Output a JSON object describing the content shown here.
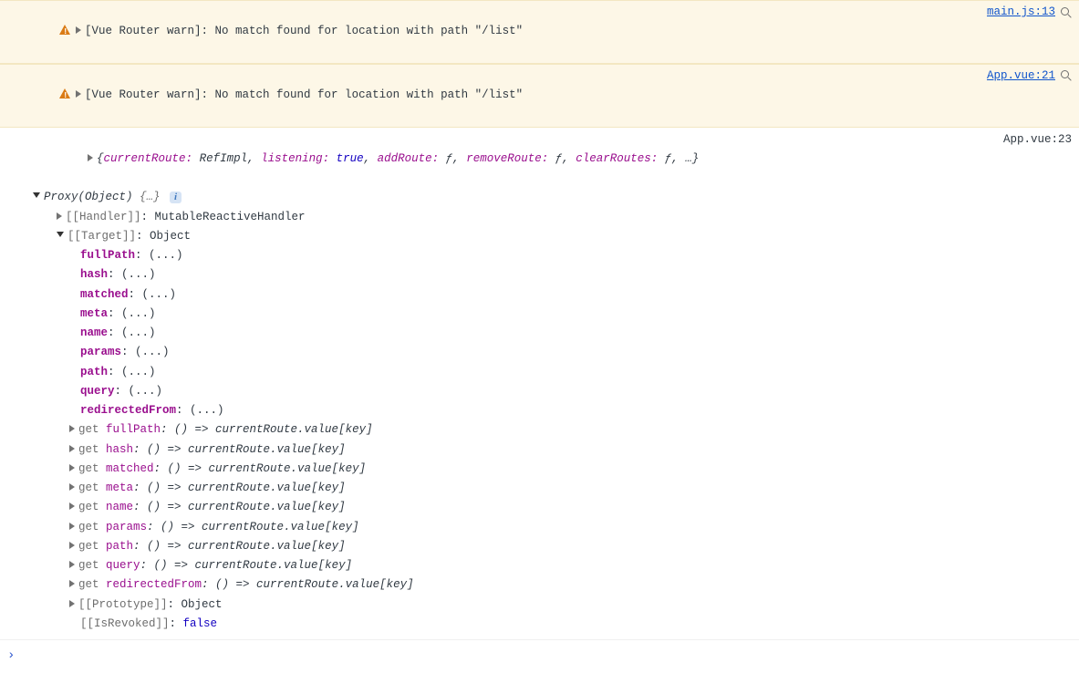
{
  "warns": [
    {
      "text": "[Vue Router warn]: No match found for location with path \"/list\"",
      "src": "main.js:13"
    },
    {
      "text": "[Vue Router warn]: No match found for location with path \"/list\"",
      "src": "App.vue:21"
    }
  ],
  "log": {
    "src": "App.vue:23",
    "summary_parts": {
      "open": "{",
      "p1k": "currentRoute:",
      "p1v": " RefImpl",
      "sep": ", ",
      "p2k": "listening:",
      "p2v": " true",
      "p3k": "addRoute:",
      "p3v": " ƒ",
      "p4k": "removeRoute:",
      "p4v": " ƒ",
      "p5k": "clearRoutes:",
      "p5v": " ƒ",
      "ell": ", …",
      "close": "}"
    },
    "proxy": {
      "label": "Proxy(Object)",
      "braces": " {…}",
      "handler_label": "[[Handler]]",
      "handler_val": ": MutableReactiveHandler",
      "target_label": "[[Target]]",
      "target_val": ": Object",
      "props": [
        {
          "k": "fullPath",
          "v": ": (...)"
        },
        {
          "k": "hash",
          "v": ": (...)"
        },
        {
          "k": "matched",
          "v": ": (...)"
        },
        {
          "k": "meta",
          "v": ": (...)"
        },
        {
          "k": "name",
          "v": ": (...)"
        },
        {
          "k": "params",
          "v": ": (...)"
        },
        {
          "k": "path",
          "v": ": (...)"
        },
        {
          "k": "query",
          "v": ": (...)"
        },
        {
          "k": "redirectedFrom",
          "v": ": (...)"
        }
      ],
      "getters": [
        {
          "g": "get ",
          "k": "fullPath",
          "v": ": () => currentRoute.value[key]"
        },
        {
          "g": "get ",
          "k": "hash",
          "v": ": () => currentRoute.value[key]"
        },
        {
          "g": "get ",
          "k": "matched",
          "v": ": () => currentRoute.value[key]"
        },
        {
          "g": "get ",
          "k": "meta",
          "v": ": () => currentRoute.value[key]"
        },
        {
          "g": "get ",
          "k": "name",
          "v": ": () => currentRoute.value[key]"
        },
        {
          "g": "get ",
          "k": "params",
          "v": ": () => currentRoute.value[key]"
        },
        {
          "g": "get ",
          "k": "path",
          "v": ": () => currentRoute.value[key]"
        },
        {
          "g": "get ",
          "k": "query",
          "v": ": () => currentRoute.value[key]"
        },
        {
          "g": "get ",
          "k": "redirectedFrom",
          "v": ": () => currentRoute.value[key]"
        }
      ],
      "proto_label": "[[Prototype]]",
      "proto_val": ": Object",
      "revoked_label": "[[IsRevoked]]",
      "revoked_val_pre": ": ",
      "revoked_val": "false"
    }
  },
  "prompt": "›"
}
